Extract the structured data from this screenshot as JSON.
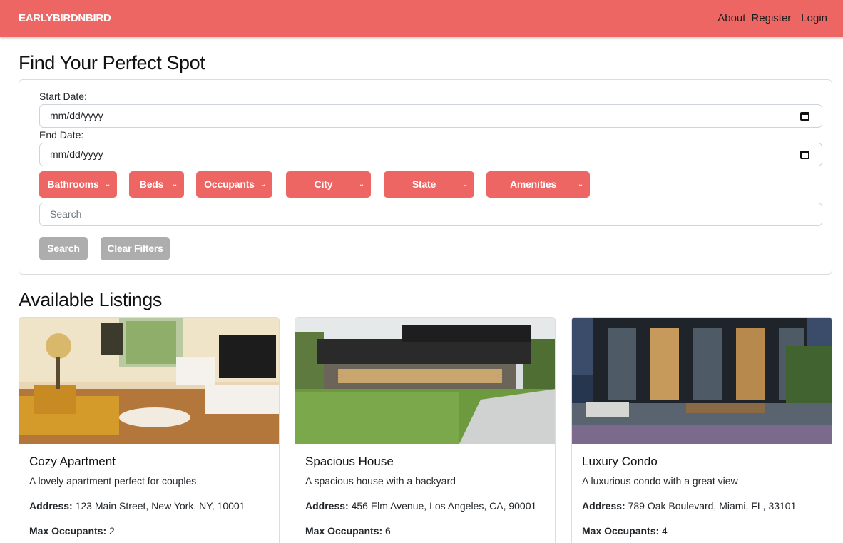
{
  "nav": {
    "brand": "EARLYBIRDNBIRD",
    "links": [
      "About",
      "Register",
      "Login"
    ]
  },
  "search_section": {
    "title": "Find Your Perfect Spot",
    "start_date_label": "Start Date:",
    "start_date_value": "mm/dd/yyyy",
    "end_date_label": "End Date:",
    "end_date_value": "mm/dd/yyyy",
    "filters": [
      "Bathrooms",
      "Beds",
      "Occupants",
      "City",
      "State",
      "Amenities"
    ],
    "search_placeholder": "Search",
    "search_button": "Search",
    "clear_button": "Clear Filters",
    "accent_color": "#ed6663"
  },
  "listings_section": {
    "title": "Available Listings",
    "address_label": "Address:",
    "occupants_label": "Max Occupants:",
    "listings": [
      {
        "title": "Cozy Apartment",
        "description": "A lovely apartment perfect for couples",
        "address": "123 Main Street, New York, NY, 10001",
        "max_occupants": "2"
      },
      {
        "title": "Spacious House",
        "description": "A spacious house with a backyard",
        "address": "456 Elm Avenue, Los Angeles, CA, 90001",
        "max_occupants": "6"
      },
      {
        "title": "Luxury Condo",
        "description": "A luxurious condo with a great view",
        "address": "789 Oak Boulevard, Miami, FL, 33101",
        "max_occupants": "4"
      }
    ]
  }
}
